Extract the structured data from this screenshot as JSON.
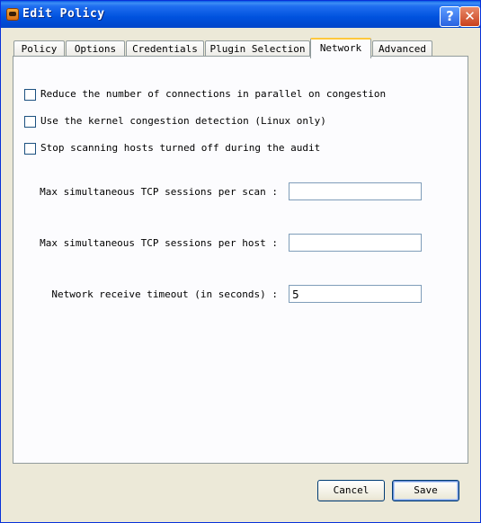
{
  "window": {
    "title": "Edit Policy",
    "help_glyph": "?",
    "close_glyph": "✕"
  },
  "tabs": [
    {
      "label": "Policy"
    },
    {
      "label": "Options"
    },
    {
      "label": "Credentials"
    },
    {
      "label": "Plugin Selection"
    },
    {
      "label": "Network",
      "active": true
    },
    {
      "label": "Advanced"
    }
  ],
  "checkboxes": [
    {
      "label": "Reduce the number of connections in parallel on congestion",
      "checked": false
    },
    {
      "label": "Use the kernel congestion detection (Linux only)",
      "checked": false
    },
    {
      "label": "Stop scanning hosts turned off during the audit",
      "checked": false
    }
  ],
  "fields": [
    {
      "label": "Max simultaneous TCP sessions per scan :",
      "value": ""
    },
    {
      "label": "Max simultaneous TCP sessions per host :",
      "value": ""
    },
    {
      "label": "Network receive timeout (in seconds) :",
      "value": "5"
    }
  ],
  "buttons": {
    "cancel": "Cancel",
    "save": "Save"
  },
  "colors": {
    "titlebar": "#0052de",
    "active_tab_accent": "#ffc83c",
    "dialog_bg": "#ece9d8"
  },
  "icons": {
    "app": "nessus-app-icon",
    "help": "help-icon",
    "close": "close-icon"
  }
}
